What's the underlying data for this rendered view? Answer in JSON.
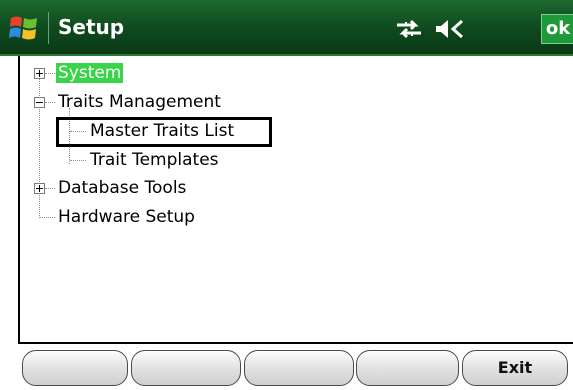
{
  "titlebar": {
    "title": "Setup",
    "ok_label": "ok",
    "icons": [
      "windows-start-icon",
      "connectivity-icon",
      "volume-muted-icon"
    ]
  },
  "tree": {
    "nodes": [
      {
        "label": "System",
        "expander": "plus",
        "selected": true
      },
      {
        "label": "Traits Management",
        "expander": "minus",
        "selected": false
      },
      {
        "label": "Master Traits List",
        "expander": null,
        "selected": false,
        "focused": true
      },
      {
        "label": "Trait Templates",
        "expander": null,
        "selected": false
      },
      {
        "label": "Database Tools",
        "expander": "plus",
        "selected": false
      },
      {
        "label": "Hardware Setup",
        "expander": null,
        "selected": false
      }
    ]
  },
  "softkeys": [
    "",
    "",
    "",
    "",
    "Exit"
  ],
  "colors": {
    "titlebar": "#0f4b1f",
    "ok_button": "#1f9a3a",
    "selection": "#3ad34a"
  }
}
